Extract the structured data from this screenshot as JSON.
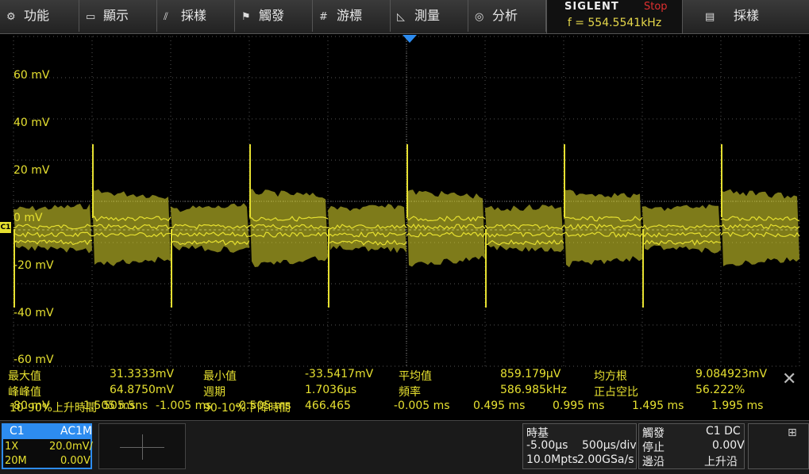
{
  "menu": {
    "items": [
      {
        "label": "功能",
        "icon": "gear-icon"
      },
      {
        "label": "顯示",
        "icon": "monitor-icon"
      },
      {
        "label": "採樣",
        "icon": "sampling-icon"
      },
      {
        "label": "觸發",
        "icon": "flag-icon"
      },
      {
        "label": "游標",
        "icon": "cursor-grid-icon"
      },
      {
        "label": "測量",
        "icon": "measure-icon"
      },
      {
        "label": "分析",
        "icon": "analysis-icon"
      },
      {
        "label": "採樣",
        "icon": "list-icon"
      }
    ],
    "brand": "SIGLENT",
    "run_state": "Stop",
    "frequency": "f = 554.5541kHz"
  },
  "waveform": {
    "y_labels": [
      "60 mV",
      "40 mV",
      "20 mV",
      "0 mV",
      "-20 mV",
      "-40 mV",
      "-60 mV"
    ],
    "channel_marker": "C1",
    "trace_color": "#e6e030"
  },
  "measurements": {
    "row1": [
      {
        "label": "最大值",
        "value": "31.3333mV"
      },
      {
        "label": "最小值",
        "value": "-33.5417mV"
      },
      {
        "label": "平均值",
        "value": "859.179µV"
      },
      {
        "label": "均方根",
        "value": "9.084923mV"
      }
    ],
    "row2": [
      {
        "label": "峰峰值",
        "value": "64.8750mV"
      },
      {
        "label": "週期",
        "value": "1.7036µs"
      },
      {
        "label": "頻率",
        "value": "586.985kHz"
      },
      {
        "label": "正占空比",
        "value": "56.222%"
      }
    ],
    "row3_overlap": [
      "10-90%上升時間",
      "505.5ns",
      "90-10%下降時間",
      "466.465",
      "-80 mV"
    ],
    "time_ticks": [
      "-1.505 ms",
      "-1.005 ms",
      "-0.505 ms",
      "-0.005 ms",
      "0.495 ms",
      "0.995 ms",
      "1.495 ms",
      "1.995 ms"
    ]
  },
  "channel1": {
    "name": "C1",
    "coupling": "AC1M",
    "probe": "1X",
    "scale": "20.0mV/",
    "bandwidth": "20M",
    "offset": "0.00V"
  },
  "timebase": {
    "title": "時基",
    "delay": "-5.00µs",
    "scale": "500µs/div",
    "memory": "10.0Mpts",
    "sample_rate": "2.00GSa/s"
  },
  "trigger": {
    "title": "觸發",
    "source": "C1 DC",
    "state_label": "停止",
    "level": "0.00V",
    "edge_label": "邊沿",
    "slope": "上升沿"
  }
}
